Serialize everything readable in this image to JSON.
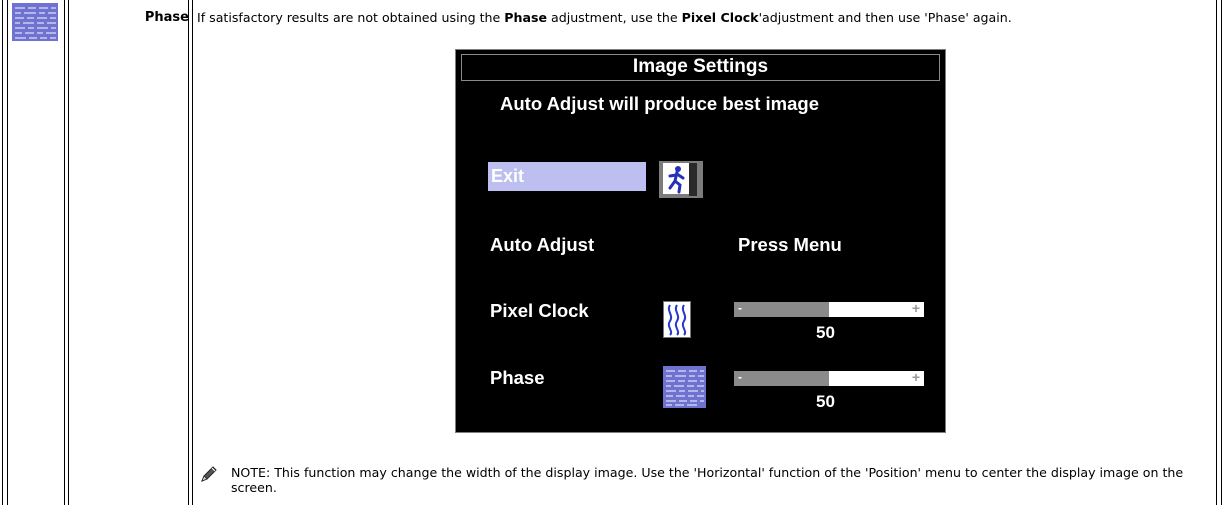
{
  "row": {
    "label": "Phase",
    "intro": {
      "part1": "If satisfactory results are not obtained using the ",
      "bold1": "Phase",
      "part2": " adjustment, use the ",
      "bold2": "Pixel Clock",
      "part3": "'adjustment and then use 'Phase' again."
    }
  },
  "osd": {
    "title": "Image Settings",
    "message": "Auto Adjust will produce best image",
    "exit_label": "Exit",
    "auto_adjust_label": "Auto Adjust",
    "press_menu_label": "Press Menu",
    "pixel_clock": {
      "label": "Pixel Clock",
      "value": "50",
      "level": 0.5,
      "minus": "-",
      "plus": "+"
    },
    "phase": {
      "label": "Phase",
      "value": "50",
      "level": 0.5,
      "minus": "-",
      "plus": "+"
    }
  },
  "note": {
    "text": "NOTE: This function may change the width of the display image. Use the 'Horizontal' function of the 'Position' menu to center the display image on the screen."
  },
  "icons": {
    "row_icon": "phase-pattern-icon",
    "exit_icon": "exit-running-man-icon",
    "pixel_clock_icon": "wave-icon",
    "phase_icon": "phase-pattern-icon",
    "note_icon": "pencil-icon"
  }
}
